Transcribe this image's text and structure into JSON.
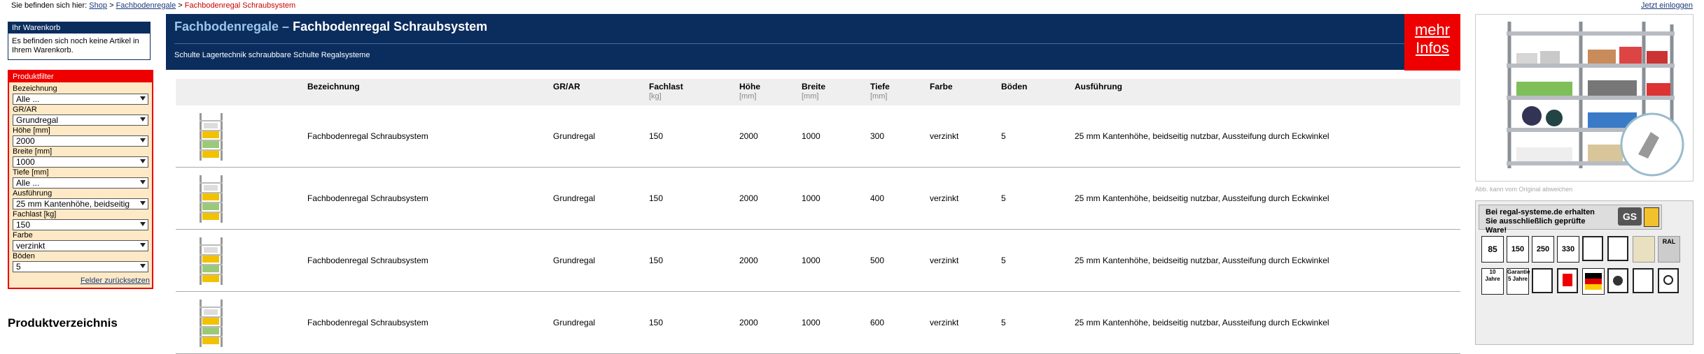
{
  "breadcrumb": {
    "prefix": "Sie befinden sich hier:",
    "items": [
      "Shop",
      "Fachbodenregale"
    ],
    "current": "Fachbodenregal Schraubsystem",
    "sep": ">"
  },
  "login": "Jetzt einloggen",
  "cart": {
    "title": "Ihr Warenkorb",
    "text": "Es befinden sich noch keine Artikel in Ihrem Warenkorb."
  },
  "filter": {
    "title": "Produktfilter",
    "fields": [
      {
        "label": "Bezeichnung",
        "value": "Alle ..."
      },
      {
        "label": "GR/AR",
        "value": "Grundregal"
      },
      {
        "label": "Höhe [mm]",
        "value": "2000"
      },
      {
        "label": "Breite [mm]",
        "value": "1000"
      },
      {
        "label": "Tiefe [mm]",
        "value": "Alle ..."
      },
      {
        "label": "Ausführung",
        "value": "25 mm Kantenhöhe, beidseitig"
      },
      {
        "label": "Fachlast [kg]",
        "value": "150"
      },
      {
        "label": "Farbe",
        "value": "verzinkt"
      },
      {
        "label": "Böden",
        "value": "5"
      }
    ],
    "reset": "Felder zurücksetzen"
  },
  "produktverzeichnis": "Produktverzeichnis",
  "header": {
    "title_part1": "Fachbodenregale –",
    "title_part2": "Fachbodenregal Schraubsystem",
    "subtitle": "Schulte Lagertechnik schraubbare Schulte Regalsysteme",
    "mehr": "mehr",
    "infos": "Infos"
  },
  "table": {
    "columns": [
      {
        "label": "Bezeichnung",
        "unit": ""
      },
      {
        "label": "GR/AR",
        "unit": ""
      },
      {
        "label": "Fachlast",
        "unit": "[kg]"
      },
      {
        "label": "Höhe",
        "unit": "[mm]"
      },
      {
        "label": "Breite",
        "unit": "[mm]"
      },
      {
        "label": "Tiefe",
        "unit": "[mm]"
      },
      {
        "label": "Farbe",
        "unit": ""
      },
      {
        "label": "Böden",
        "unit": ""
      },
      {
        "label": "Ausführung",
        "unit": ""
      }
    ],
    "rows": [
      [
        "Fachbodenregal Schraubsystem",
        "Grundregal",
        "150",
        "2000",
        "1000",
        "300",
        "verzinkt",
        "5",
        "25 mm Kantenhöhe, beidseitig nutzbar, Aussteifung durch Eckwinkel"
      ],
      [
        "Fachbodenregal Schraubsystem",
        "Grundregal",
        "150",
        "2000",
        "1000",
        "400",
        "verzinkt",
        "5",
        "25 mm Kantenhöhe, beidseitig nutzbar, Aussteifung durch Eckwinkel"
      ],
      [
        "Fachbodenregal Schraubsystem",
        "Grundregal",
        "150",
        "2000",
        "1000",
        "500",
        "verzinkt",
        "5",
        "25 mm Kantenhöhe, beidseitig nutzbar, Aussteifung durch Eckwinkel"
      ],
      [
        "Fachbodenregal Schraubsystem",
        "Grundregal",
        "150",
        "2000",
        "1000",
        "600",
        "verzinkt",
        "5",
        "25 mm Kantenhöhe, beidseitig nutzbar, Aussteifung durch Eckwinkel"
      ]
    ]
  },
  "product_image_caption": "Abb. kann vom Original abweichen",
  "quality": {
    "text": "Bei regal-systeme.de erhalten Sie ausschließlich geprüfte Ware!",
    "badges_row1": [
      "85 kg",
      "150 kg",
      "250 kg",
      "330 kg"
    ],
    "ral": "RAL",
    "badges_row2": [
      "10 Jahre",
      "Garantie 5 Jahre"
    ]
  },
  "colors": {
    "navy": "#0b2d5e",
    "red": "#e00000",
    "filter_bg": "#fde9c5"
  }
}
